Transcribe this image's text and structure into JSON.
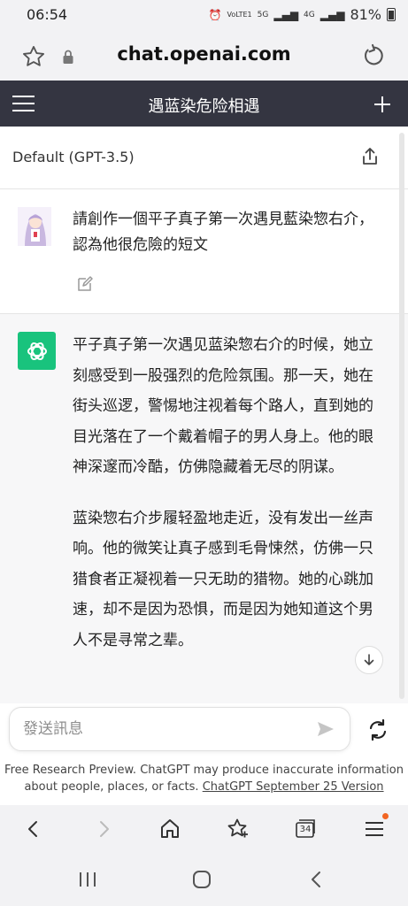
{
  "status_bar": {
    "time": "06:54",
    "network_labels": [
      "VoLTE1",
      "5G",
      "4G"
    ],
    "battery": "81%"
  },
  "browser": {
    "url": "chat.openai.com",
    "tabs_count": "34",
    "icons": [
      "star-icon",
      "lock-icon",
      "reload-icon",
      "back-icon",
      "forward-icon",
      "home-icon",
      "bookmarks-icon",
      "tabs-icon",
      "menu-icon"
    ]
  },
  "chat_header": {
    "title": "遇蓝染危险相遇"
  },
  "model": {
    "label": "Default (GPT-3.5)"
  },
  "user_message": {
    "text": "請創作一個平子真子第一次遇見藍染惣右介，認為他很危險的短文"
  },
  "assistant_message": {
    "paragraphs": [
      "平子真子第一次遇见蓝染惣右介的时候，她立刻感受到一股强烈的危险氛围。那一天，她在街头巡逻，警惕地注视着每个路人，直到她的目光落在了一个戴着帽子的男人身上。他的眼神深邃而冷酷，仿佛隐藏着无尽的阴谋。",
      "蓝染惣右介步履轻盈地走近，没有发出一丝声响。他的微笑让真子感到毛骨悚然，仿佛一只猎食者正凝视着一只无助的猎物。她的心跳加速，却不是因为恐惧，而是因为她知道这个男人不是寻常之辈。"
    ]
  },
  "input": {
    "placeholder": "發送訊息"
  },
  "footer": {
    "text": "Free Research Preview. ChatGPT may produce inaccurate information about people, places, or facts. ",
    "link": "ChatGPT September 25 Version"
  },
  "colors": {
    "header_bg": "#343541",
    "gpt_green": "#19c37d",
    "assistant_bg": "#f7f7f8",
    "notification_dot": "#f26522"
  }
}
